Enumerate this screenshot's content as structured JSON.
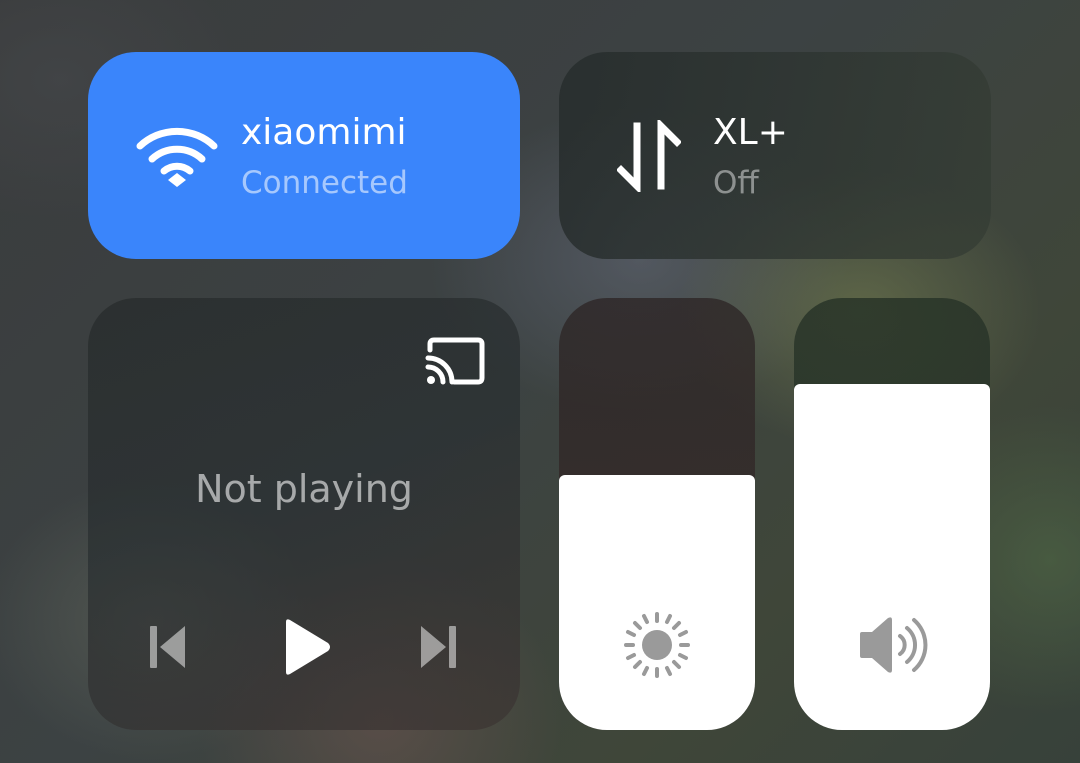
{
  "wifi": {
    "name": "xiaomimi",
    "status": "Connected",
    "active": true,
    "icon": "wifi-icon",
    "color": "#3a85fb"
  },
  "mobile_data": {
    "name": "XL+",
    "status": "Off",
    "active": false,
    "icon": "mobile-data-arrows-icon"
  },
  "media": {
    "status": "Not playing",
    "cast_icon": "cast-icon",
    "controls": [
      "previous-icon",
      "play-icon",
      "next-icon"
    ]
  },
  "brightness": {
    "level_percent": 59,
    "icon": "sun-icon"
  },
  "volume": {
    "level_percent": 80,
    "icon": "speaker-icon"
  }
}
